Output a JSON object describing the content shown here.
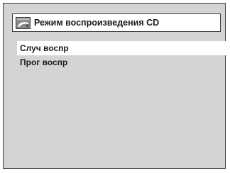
{
  "dialog": {
    "title": "Режим воспроизведения CD",
    "icon": "disc-playback-icon",
    "selected_index": 0,
    "items": [
      {
        "label": "Случ воспр"
      },
      {
        "label": "Прог воспр"
      }
    ]
  },
  "colors": {
    "background": "#d4d4d4",
    "border": "#3a3a3a",
    "highlight": "#ffffff",
    "text": "#1a1a1a"
  }
}
